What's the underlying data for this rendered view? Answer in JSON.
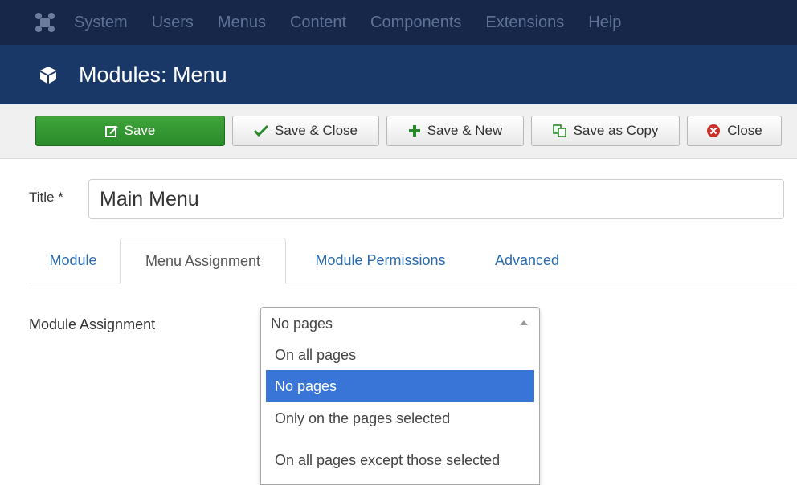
{
  "topnav": {
    "items": [
      "System",
      "Users",
      "Menus",
      "Content",
      "Components",
      "Extensions",
      "Help"
    ]
  },
  "header": {
    "title": "Modules: Menu"
  },
  "toolbar": {
    "save_label": "Save",
    "save_close_label": "Save & Close",
    "save_new_label": "Save & New",
    "save_copy_label": "Save as Copy",
    "close_label": "Close"
  },
  "form": {
    "title_label": "Title *",
    "title_value": "Main Menu"
  },
  "tabs": [
    "Module",
    "Menu Assignment",
    "Module Permissions",
    "Advanced"
  ],
  "assignment": {
    "label": "Module Assignment",
    "selected": "No pages",
    "options": [
      "On all pages",
      "No pages",
      "Only on the pages selected",
      "On all pages except those selected"
    ]
  },
  "colors": {
    "nav_bg": "#16274a",
    "header_bg": "#1a3867",
    "save_green": "#2f9a2f",
    "link_blue": "#2b6aab",
    "highlight": "#3875d7"
  }
}
